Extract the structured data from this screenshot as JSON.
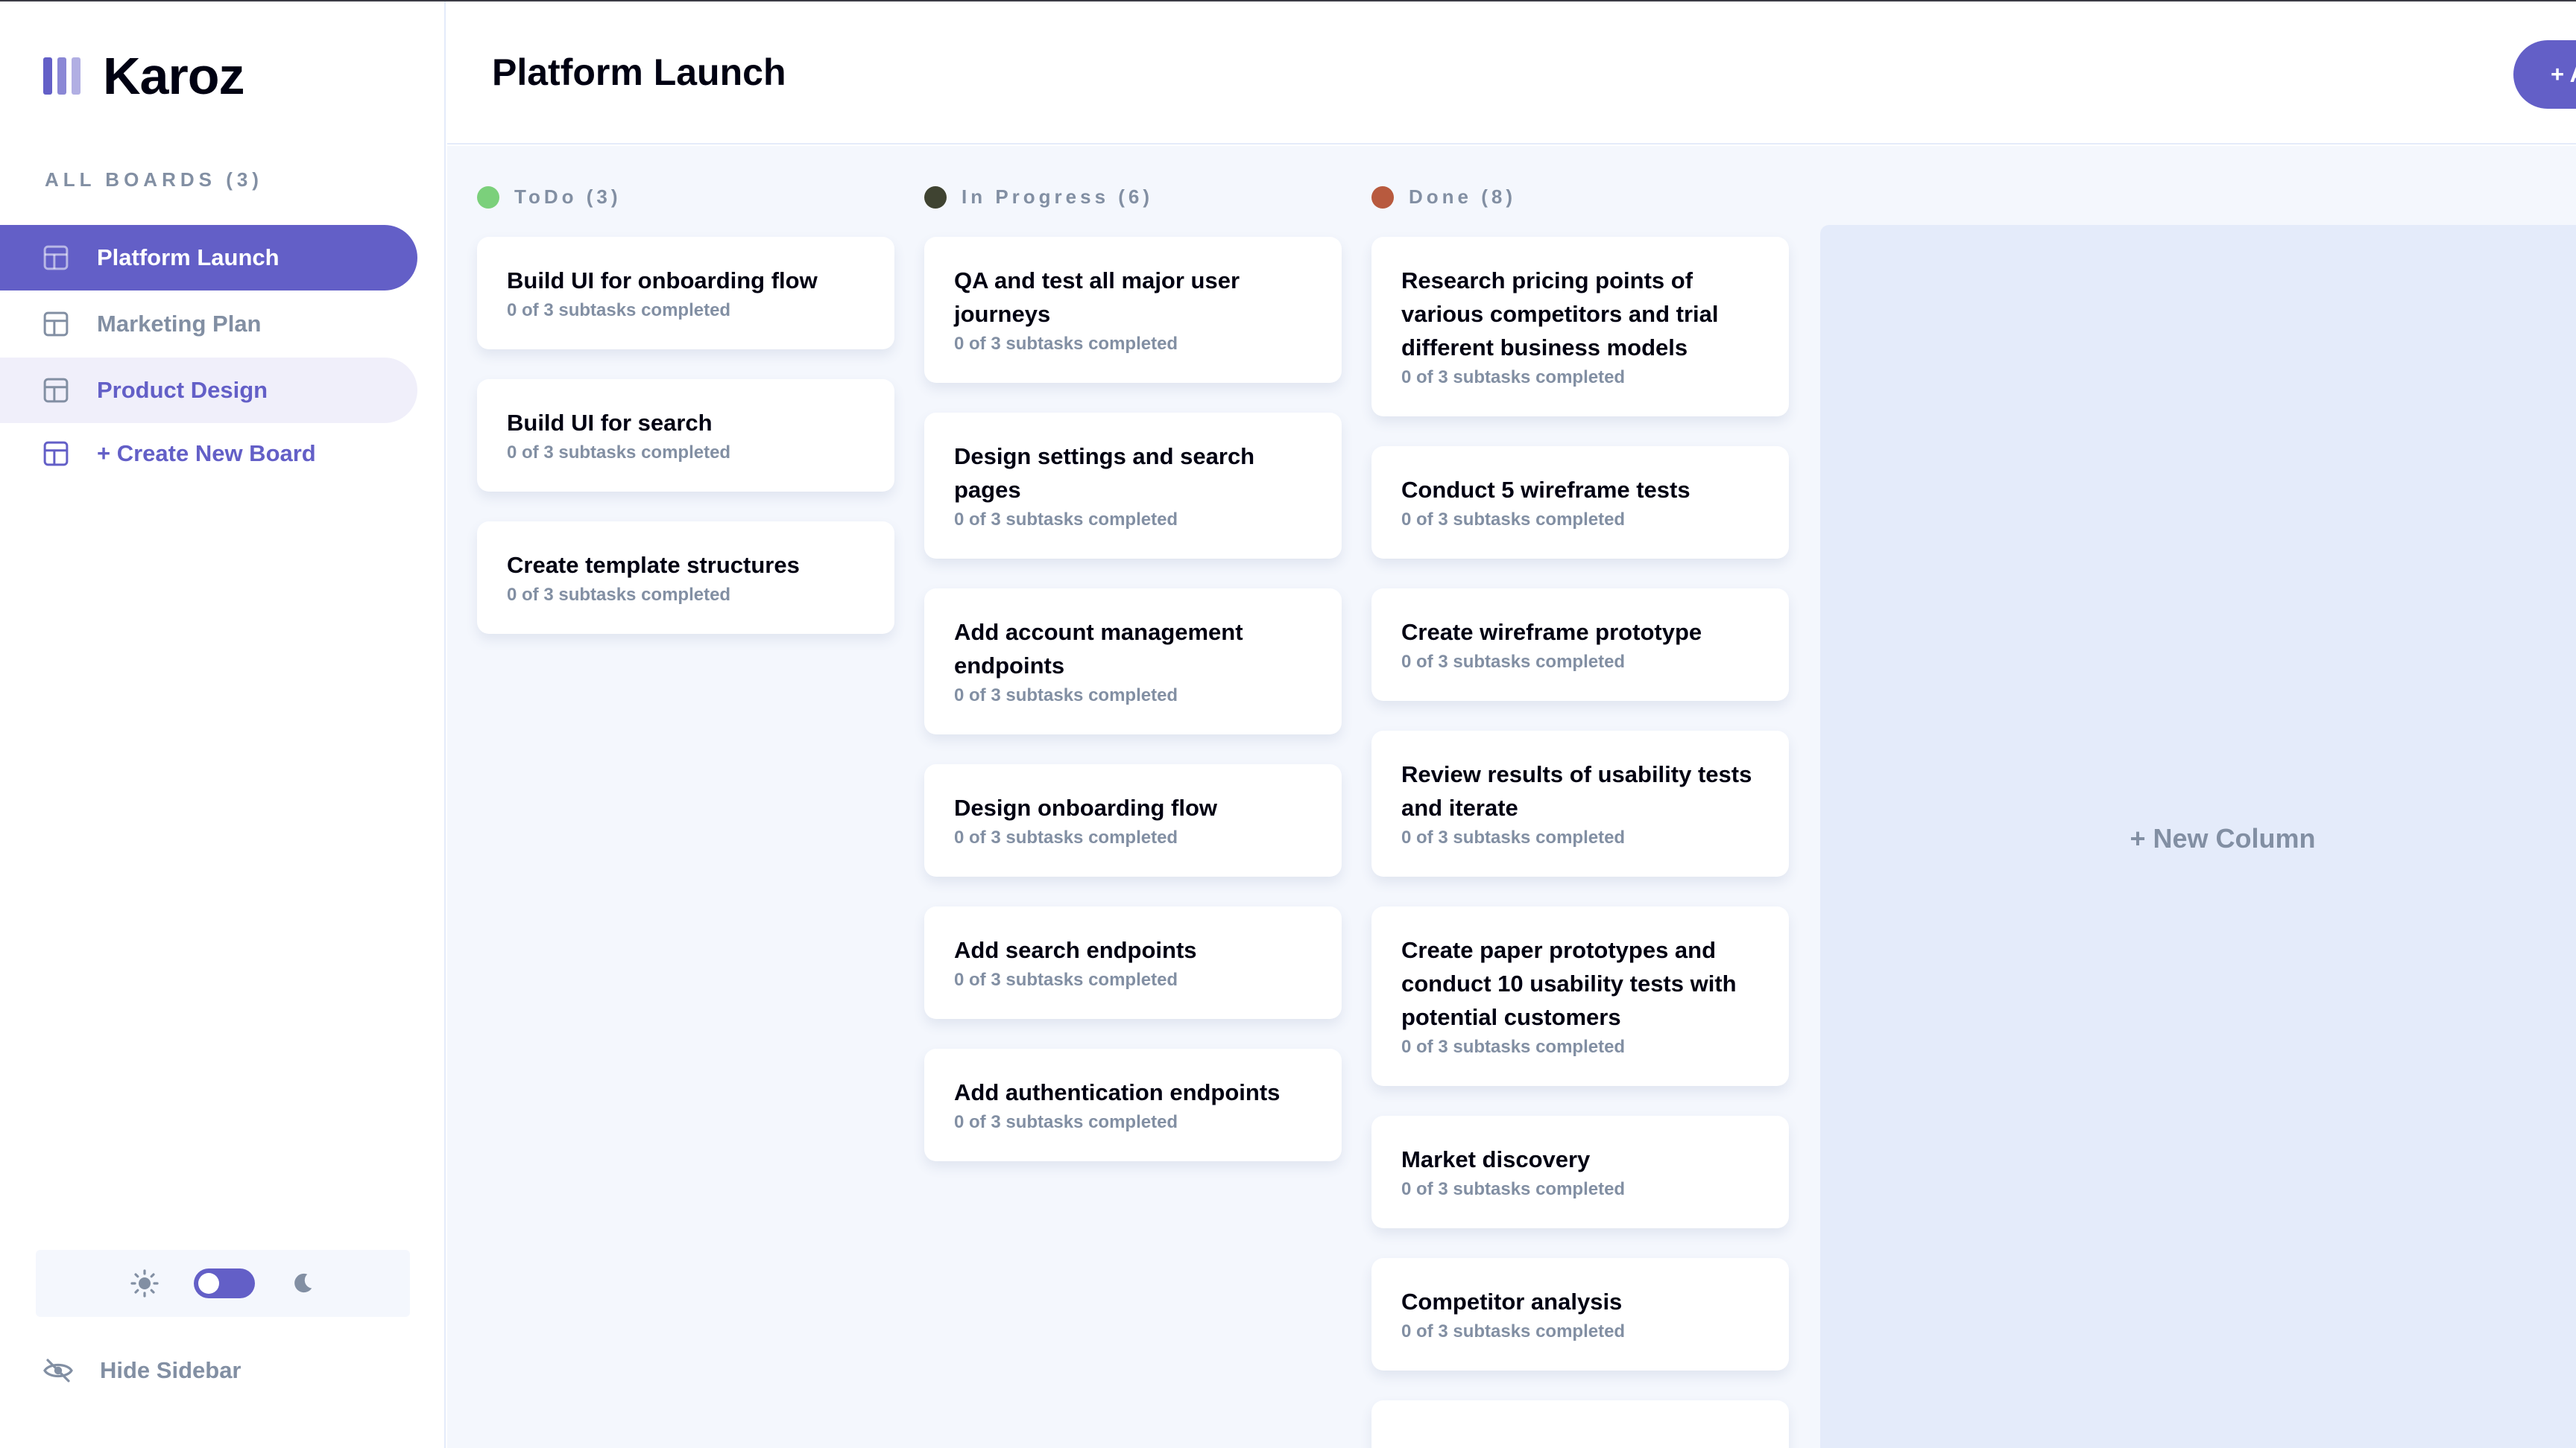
{
  "app": {
    "name": "Karoz"
  },
  "sidebar": {
    "heading": "ALL BOARDS (3)",
    "boards": [
      {
        "label": "Platform Launch",
        "state": "active"
      },
      {
        "label": "Marketing Plan",
        "state": "normal"
      },
      {
        "label": "Product Design",
        "state": "hovered"
      }
    ],
    "create_label": "+ Create New Board",
    "theme": {
      "light_icon": "sun-icon",
      "dark_icon": "moon-icon",
      "dark_mode": false
    },
    "hide_label": "Hide Sidebar"
  },
  "header": {
    "title": "Platform Launch",
    "add_task_label": "+ Add New Task"
  },
  "columns": [
    {
      "name": "ToDo (3)",
      "color": "#7bd07b",
      "tasks": [
        {
          "title": "Build UI for onboarding flow",
          "subtasks": "0 of 3 subtasks completed"
        },
        {
          "title": "Build UI for search",
          "subtasks": "0 of 3 subtasks completed"
        },
        {
          "title": "Create template structures",
          "subtasks": "0 of 3 subtasks completed"
        }
      ]
    },
    {
      "name": "In Progress (6)",
      "color": "#3f4331",
      "tasks": [
        {
          "title": "QA and test all major user journeys",
          "subtasks": "0 of 3 subtasks completed"
        },
        {
          "title": "Design settings and search pages",
          "subtasks": "0 of 3 subtasks completed"
        },
        {
          "title": "Add account management endpoints",
          "subtasks": "0 of 3 subtasks completed"
        },
        {
          "title": "Design onboarding flow",
          "subtasks": "0 of 3 subtasks completed"
        },
        {
          "title": "Add search endpoints",
          "subtasks": "0 of 3 subtasks completed"
        },
        {
          "title": "Add authentication endpoints",
          "subtasks": "0 of 3 subtasks completed"
        }
      ]
    },
    {
      "name": "Done (8)",
      "color": "#b85a3e",
      "tasks": [
        {
          "title": "Research pricing points of various competitors and trial different business models",
          "subtasks": "0 of 3 subtasks completed"
        },
        {
          "title": "Conduct 5 wireframe tests",
          "subtasks": "0 of 3 subtasks completed"
        },
        {
          "title": "Create wireframe prototype",
          "subtasks": "0 of 3 subtasks completed"
        },
        {
          "title": "Review results of usability tests and iterate",
          "subtasks": "0 of 3 subtasks completed"
        },
        {
          "title": "Create paper prototypes and conduct 10 usability tests with potential customers",
          "subtasks": "0 of 3 subtasks completed"
        },
        {
          "title": "Market discovery",
          "subtasks": "0 of 3 subtasks completed"
        },
        {
          "title": "Competitor analysis",
          "subtasks": "0 of 3 subtasks completed"
        },
        {
          "title": "",
          "subtasks": ""
        }
      ]
    }
  ],
  "new_column_label": "+ New Column",
  "colors": {
    "accent": "#635fc7",
    "board_bg": "#f4f7fd",
    "muted_text": "#828fa3",
    "lines": "#e4ebfa"
  }
}
